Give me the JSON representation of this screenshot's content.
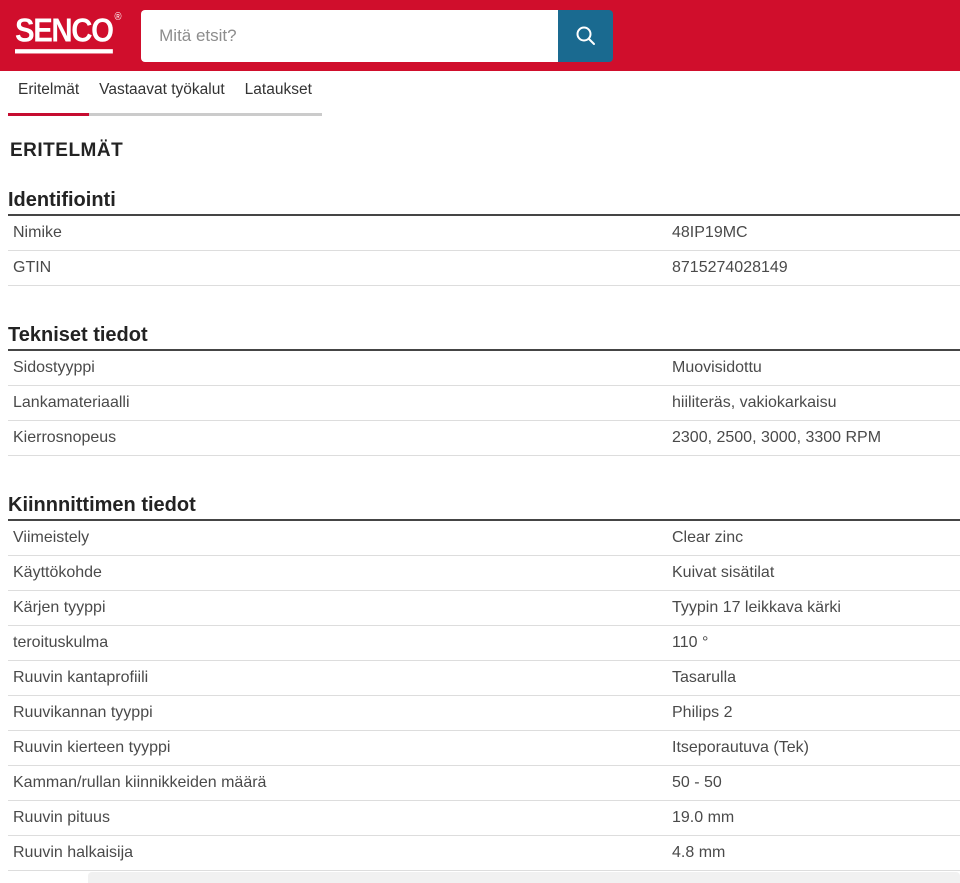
{
  "header": {
    "logo_text": "SENCO",
    "registered_mark": "®",
    "search": {
      "placeholder": "Mitä etsit?"
    }
  },
  "tabs": [
    {
      "label": "Eritelmät",
      "active": true
    },
    {
      "label": "Vastaavat työkalut",
      "active": false
    },
    {
      "label": "Lataukset",
      "active": false
    }
  ],
  "page_title": "ERITELMÄT",
  "sections": [
    {
      "title": "Identifiointi",
      "rows": [
        {
          "label": "Nimike",
          "value": "48IP19MC"
        },
        {
          "label": "GTIN",
          "value": "8715274028149"
        }
      ]
    },
    {
      "title": "Tekniset tiedot",
      "rows": [
        {
          "label": "Sidostyyppi",
          "value": "Muovisidottu"
        },
        {
          "label": "Lankamateriaalli",
          "value": "hiiliteräs, vakiokarkaisu"
        },
        {
          "label": "Kierrosnopeus",
          "value": "2300, 2500, 3000, 3300 RPM"
        }
      ]
    },
    {
      "title": "Kiinnnittimen tiedot",
      "rows": [
        {
          "label": "Viimeistely",
          "value": "Clear zinc"
        },
        {
          "label": "Käyttökohde",
          "value": "Kuivat sisätilat"
        },
        {
          "label": "Kärjen tyyppi",
          "value": "Tyypin 17 leikkava kärki"
        },
        {
          "label": "teroituskulma",
          "value": "110 °"
        },
        {
          "label": "Ruuvin kantaprofiili",
          "value": "Tasarulla"
        },
        {
          "label": "Ruuvikannan tyyppi",
          "value": "Philips 2"
        },
        {
          "label": "Ruuvin kierteen tyyppi",
          "value": "Itseporautuva (Tek)"
        },
        {
          "label": "Kamman/rullan kiinnikkeiden määrä",
          "value": "50 - 50"
        },
        {
          "label": "Ruuvin pituus",
          "value": "19.0 mm"
        },
        {
          "label": "Ruuvin halkaisija",
          "value": "4.8 mm"
        }
      ]
    }
  ],
  "colors": {
    "brand_red": "#d00e2c",
    "search_button_blue": "#1a6a90",
    "active_tab_underline": "#c60c30",
    "inactive_tab_underline": "#cbcbcb",
    "heading_text": "#232323",
    "body_text": "#4a4a4a",
    "row_divider": "#dddddd",
    "section_underline": "#454545"
  }
}
